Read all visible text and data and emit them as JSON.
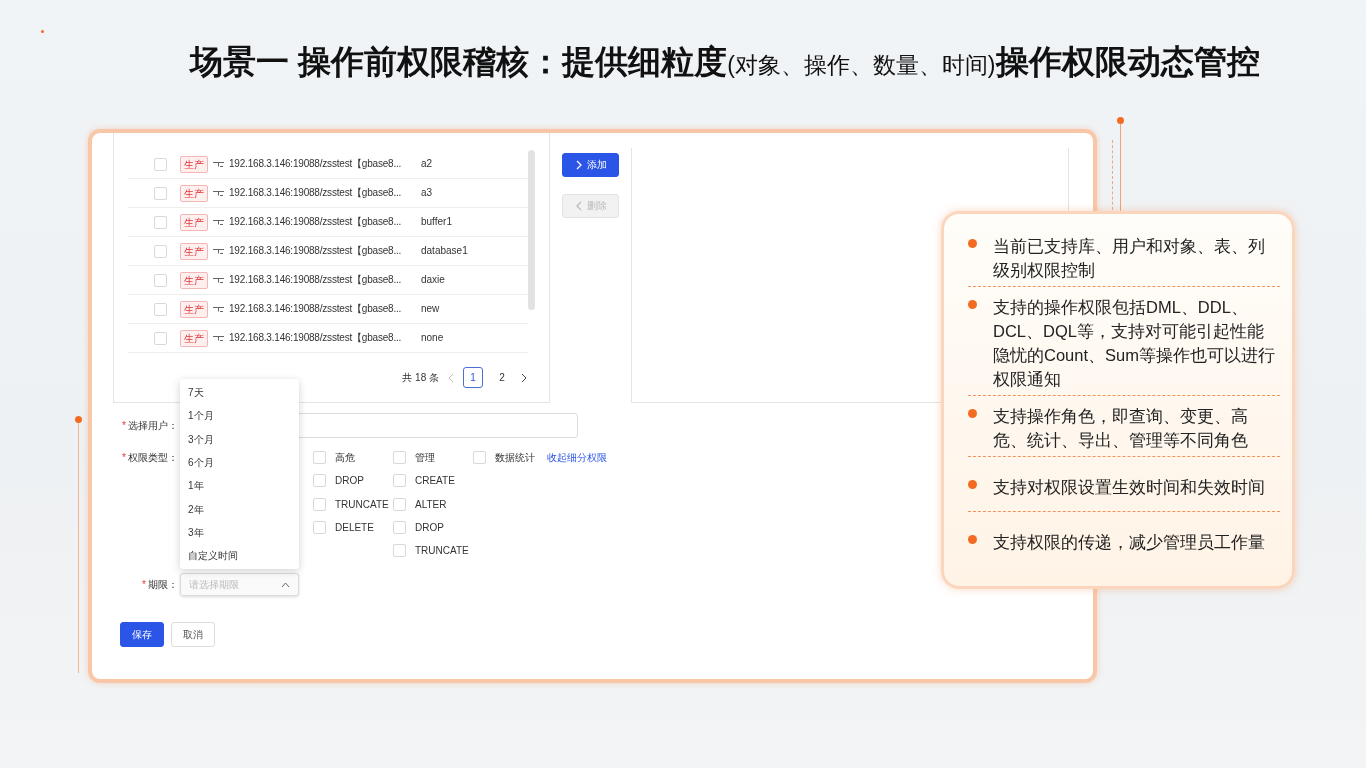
{
  "title": [
    {
      "kind": "main",
      "text": "场景一 操作前权限稽核：提供细粒度"
    },
    {
      "kind": "aside",
      "text": "(对象、操作、数量、时间)"
    },
    {
      "kind": "main",
      "text": "操作权限动态管控"
    }
  ],
  "transfer": {
    "rows": [
      {
        "checked": false,
        "tag": "生产",
        "source": "192.168.3.146:19088/zsstest【gbase8...",
        "name": "a2"
      },
      {
        "checked": false,
        "tag": "生产",
        "source": "192.168.3.146:19088/zsstest【gbase8...",
        "name": "a3"
      },
      {
        "checked": false,
        "tag": "生产",
        "source": "192.168.3.146:19088/zsstest【gbase8...",
        "name": "buffer1"
      },
      {
        "checked": false,
        "tag": "生产",
        "source": "192.168.3.146:19088/zsstest【gbase8...",
        "name": "database1"
      },
      {
        "checked": false,
        "tag": "生产",
        "source": "192.168.3.146:19088/zsstest【gbase8...",
        "name": "daxie"
      },
      {
        "checked": false,
        "tag": "生产",
        "source": "192.168.3.146:19088/zsstest【gbase8...",
        "name": "new"
      },
      {
        "checked": false,
        "tag": "生产",
        "source": "192.168.3.146:19088/zsstest【gbase8...",
        "name": "none"
      }
    ],
    "total": "共 18 条",
    "pages": [
      {
        "label": "1",
        "selected": true
      },
      {
        "label": "2",
        "selected": false
      }
    ],
    "add_button": {
      "label": "添加",
      "disabled": false
    },
    "remove_button": {
      "label": "删除",
      "disabled": true
    }
  },
  "form": {
    "user": {
      "label": "选择用户：",
      "required_mark": "*"
    },
    "permission": {
      "label": "权限类型：",
      "required_mark": "*",
      "columns": [
        [
          {
            "label": "高危",
            "checked": false
          },
          {
            "label": "DROP",
            "checked": false
          },
          {
            "label": "TRUNCATE",
            "checked": false
          },
          {
            "label": "DELETE",
            "checked": false
          }
        ],
        [
          {
            "label": "管理",
            "checked": false
          },
          {
            "label": "CREATE",
            "checked": false
          },
          {
            "label": "ALTER",
            "checked": false
          },
          {
            "label": "DROP",
            "checked": false
          },
          {
            "label": "TRUNCATE",
            "checked": false
          }
        ],
        [
          {
            "label": "数据统计",
            "checked": false
          }
        ]
      ],
      "collapse_link": "收起细分权限"
    },
    "term": {
      "label": "期限：",
      "required_mark": "*",
      "placeholder": "请选择期限",
      "expanded": true,
      "options": [
        "7天",
        "1个月",
        "3个月",
        "6个月",
        "1年",
        "2年",
        "3年",
        "自定义时间"
      ]
    },
    "buttons": [
      {
        "label": "保存",
        "kind": "primary"
      },
      {
        "label": "取消",
        "kind": "default"
      }
    ]
  },
  "features": [
    "当前已支持库、用户和对象、表、列级别权限控制",
    "支持的操作权限包括DML、DDL、DCL、DQL等，支持对可能引起性能隐忧的Count、Sum等操作也可以进行权限通知",
    "支持操作角色，即查询、变更、高危、统计、导出、管理等不同角色",
    "支持对权限设置生效时间和失效时间",
    "支持权限的传递，减少管理员工作量"
  ]
}
